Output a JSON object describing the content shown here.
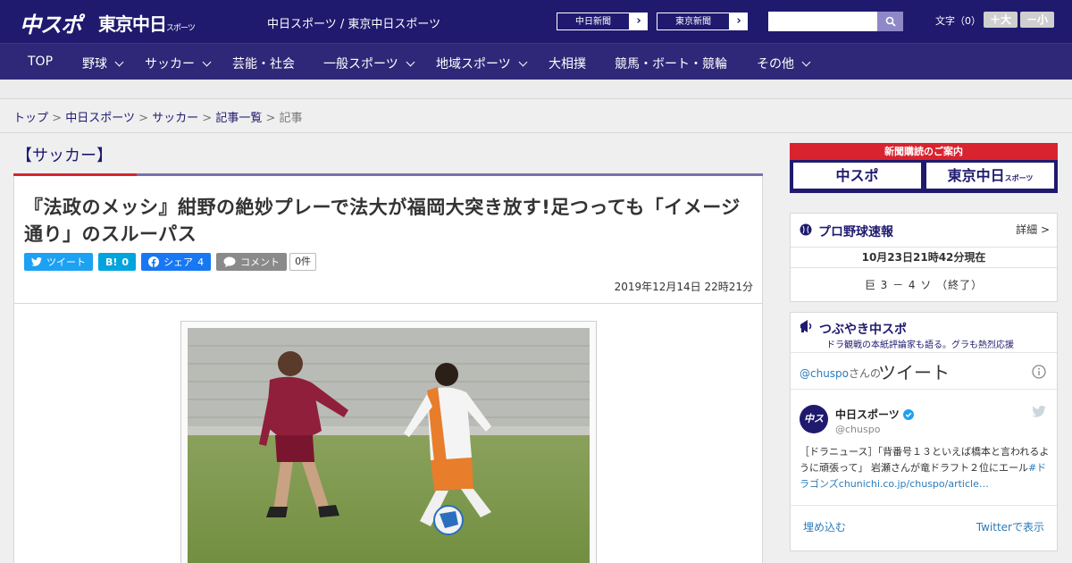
{
  "header": {
    "logo_chuspo": "中スポ",
    "logo_tokyo": "東京中日",
    "logo_tokyo_sub": "スポーツ",
    "site_title": "中日スポーツ / 東京中日スポーツ",
    "links": [
      "中日新聞",
      "東京新聞"
    ],
    "search": {
      "value": "",
      "placeholder": ""
    },
    "font_label": "文字（0）",
    "font_bigger": "＋大",
    "font_smaller": "－小"
  },
  "nav": {
    "items": [
      {
        "label": "TOP",
        "has_menu": false
      },
      {
        "label": "野球",
        "has_menu": true
      },
      {
        "label": "サッカー",
        "has_menu": true
      },
      {
        "label": "芸能・社会",
        "has_menu": false
      },
      {
        "label": "一般スポーツ",
        "has_menu": true
      },
      {
        "label": "地域スポーツ",
        "has_menu": true
      },
      {
        "label": "大相撲",
        "has_menu": false
      },
      {
        "label": "競馬・ボート・競輪",
        "has_menu": false
      },
      {
        "label": "その他",
        "has_menu": true
      }
    ]
  },
  "breadcrumb": {
    "items": [
      "トップ",
      "中日スポーツ",
      "サッカー",
      "記事一覧"
    ],
    "separator": ">",
    "current": "記事"
  },
  "article": {
    "category": "【サッカー】",
    "headline": "『法政のメッシ』紺野の絶妙プレーで法大が福岡大突き放す!足つっても「イメージ通り」のスルーパス",
    "share": {
      "tweet_label": "ツイート",
      "hatena_label": "B!",
      "hatena_count": "0",
      "facebook_label": "シェア",
      "facebook_count": "4",
      "comment_label": "コメント",
      "comment_count": "0件"
    },
    "published": "2019年12月14日 22時21分"
  },
  "sidebar": {
    "subscription": {
      "title": "新聞購読のご案内",
      "left": "中スポ",
      "right": "東京中日",
      "right_sub": "スポーツ"
    },
    "baseball": {
      "title": "プロ野球速報",
      "detail": "詳細 >",
      "updated": "10月23日21時42分現在",
      "score": "巨 3 － 4 ソ （終了）"
    },
    "tweets": {
      "title": "つぶやき中スポ",
      "subtitle": "ドラ観戦の本紙評論家も語る。グラも熱烈応援",
      "handle_prefix": "@chuspo",
      "handle_suffix": "さんの",
      "heading": "ツイート",
      "account_name": "中日スポーツ",
      "account_handle": "@chuspo",
      "tweet_text": "［ドラニュース］「背番号１３といえば橋本と言われるように頑張って」 岩瀬さんが竜ドラフト２位にエール",
      "tweet_hashtag": "#ドラゴンズ",
      "tweet_link": "chunichi.co.jp/chuspo/article…",
      "embed": "埋め込む",
      "view_on": "Twitterで表示"
    }
  },
  "colors": {
    "navy": "#1f1a6e",
    "nav_bg": "#2f2878",
    "accent_red": "#d9232e",
    "twitter": "#1da1f2",
    "facebook": "#1877f2",
    "hatena": "#00a4de"
  }
}
